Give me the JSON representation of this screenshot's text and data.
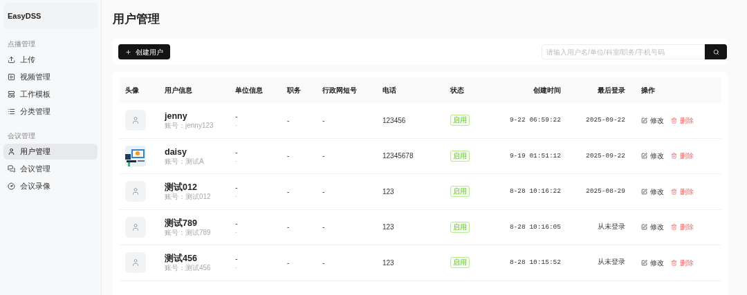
{
  "sidebar": {
    "brand": "EasyDSS",
    "groups": [
      {
        "title": "点播管理",
        "items": [
          {
            "label": "上传",
            "selected": false
          },
          {
            "label": "视频管理",
            "selected": false
          },
          {
            "label": "工作模板",
            "selected": false
          },
          {
            "label": "分类管理",
            "selected": false
          }
        ]
      },
      {
        "title": "会议管理",
        "items": [
          {
            "label": "用户管理",
            "selected": true
          },
          {
            "label": "会议管理",
            "selected": false
          },
          {
            "label": "会议录像",
            "selected": false
          }
        ]
      }
    ]
  },
  "page_title": "用户管理",
  "toolbar": {
    "create_button": "创建用户",
    "search": {
      "placeholder": "请输入用户名/单位/科室/职务/手机号码"
    }
  },
  "table": {
    "columns": [
      "头像",
      "用户信息",
      "单位信息",
      "职务",
      "行政网短号",
      "电话",
      "状态",
      "创建时间",
      "最后登录",
      "操作"
    ],
    "rows": [
      {
        "avatar": {
          "kind": "default"
        },
        "name": "jenny",
        "account": "账号：jenny123",
        "unit": "-",
        "unit_sub": "-",
        "position": "-",
        "short_number": "-",
        "phone": "123456",
        "status": {
          "text": "启用",
          "kind": "enabled"
        },
        "created": "9-22 06:59:22",
        "last_login": "2025-09-22",
        "actions": [
          "修改",
          "删除"
        ]
      },
      {
        "avatar": {
          "kind": "picture"
        },
        "name": "daisy",
        "account": "账号：测试A",
        "unit": "-",
        "unit_sub": "-",
        "position": "-",
        "short_number": "-",
        "phone": "12345678",
        "status": {
          "text": "启用",
          "kind": "enabled"
        },
        "created": "9-19 01:51:12",
        "last_login": "2025-09-22",
        "actions": [
          "修改",
          "删除"
        ]
      },
      {
        "avatar": {
          "kind": "default"
        },
        "name": "测试012",
        "account": "账号：测试012",
        "unit": "-",
        "unit_sub": "-",
        "position": "-",
        "short_number": "-",
        "phone": "123",
        "status": {
          "text": "启用",
          "kind": "enabled"
        },
        "created": "8-28 10:16:22",
        "last_login": "2025-08-29",
        "actions": [
          "修改",
          "删除"
        ]
      },
      {
        "avatar": {
          "kind": "default"
        },
        "name": "测试789",
        "account": "账号：测试789",
        "unit": "-",
        "unit_sub": "-",
        "position": "-",
        "short_number": "-",
        "phone": "123",
        "status": {
          "text": "启用",
          "kind": "enabled"
        },
        "created": "8-28 10:16:05",
        "last_login": "从未登录",
        "actions": [
          "修改",
          "删除"
        ]
      },
      {
        "avatar": {
          "kind": "default"
        },
        "name": "测试456",
        "account": "账号：测试456",
        "unit": "-",
        "unit_sub": "-",
        "position": "-",
        "short_number": "-",
        "phone": "123",
        "status": {
          "text": "启用",
          "kind": "enabled"
        },
        "created": "8-28 10:15:52",
        "last_login": "从未登录",
        "actions": [
          "修改",
          "删除"
        ]
      }
    ]
  }
}
